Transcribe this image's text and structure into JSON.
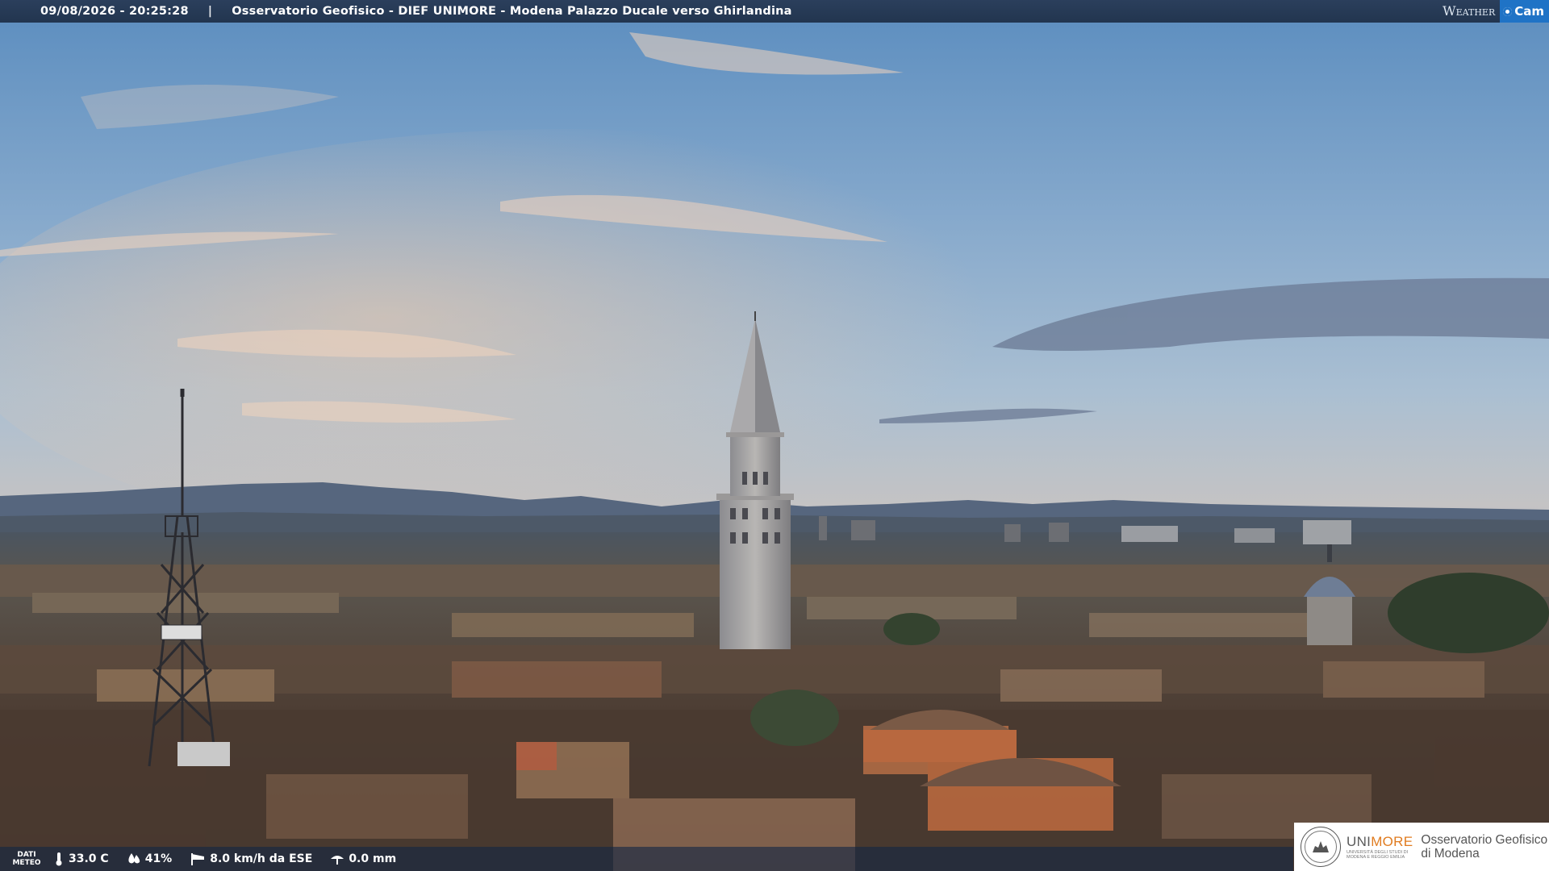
{
  "header": {
    "datetime": "09/08/2026 - 20:25:28",
    "separator": "|",
    "location": "Osservatorio Geofisico - DIEF UNIMORE - Modena Palazzo Ducale verso Ghirlandina",
    "brand_weather": "Weather",
    "brand_cam": "Cam"
  },
  "weather": {
    "dati_line1": "DATI",
    "dati_line2": "METEO",
    "temperature": "33.0 C",
    "humidity": "41%",
    "wind": "8.0 km/h da ESE",
    "rain": "0.0 mm",
    "icons": [
      "thermometer-icon",
      "humidity-drop-icon",
      "wind-sock-icon",
      "rain-gauge-icon"
    ]
  },
  "logo": {
    "unimore_a": "UNI",
    "unimore_b": "MORE",
    "university_small": "UNIVERSITÀ DEGLI STUDI DI MODENA E REGGIO EMILIA",
    "observatory_line1": "Osservatorio Geofisico",
    "observatory_line2": "di Modena",
    "accent_color": "#e07b1f"
  },
  "colors": {
    "header_bg": "#2b3f5c",
    "brand_blue": "#1f73c6"
  }
}
